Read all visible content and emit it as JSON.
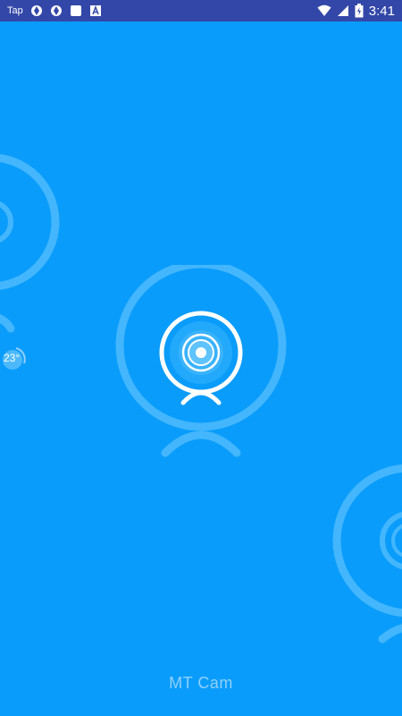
{
  "status_bar": {
    "app_label": "Tap",
    "time": "3:41",
    "icons_left": [
      "aperture-icon",
      "aperture-icon",
      "square-icon",
      "a-box-icon"
    ],
    "icons_right": [
      "wifi-icon",
      "signal-icon",
      "battery-icon"
    ]
  },
  "weather": {
    "temperature": "23°"
  },
  "app": {
    "name": "MT Cam"
  },
  "colors": {
    "background": "#0a9cfb",
    "status_bar": "#3347a8",
    "ring_faint": "#43b6fd",
    "logo_white": "#ffffff"
  }
}
